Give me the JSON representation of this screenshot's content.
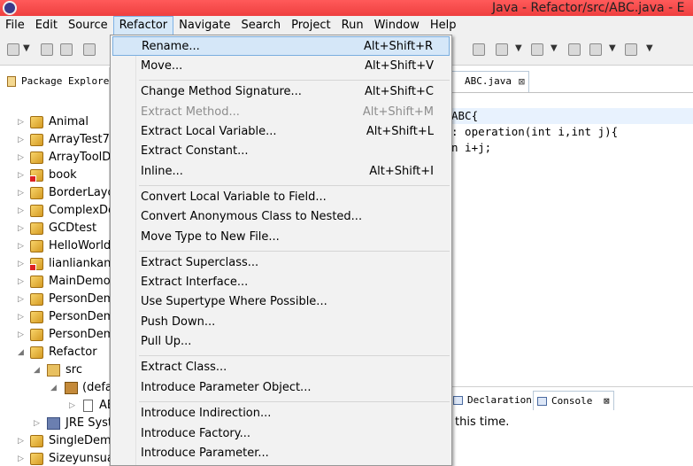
{
  "window": {
    "title": "Java - Refactor/src/ABC.java - E"
  },
  "menubar": {
    "items": [
      "File",
      "Edit",
      "Source",
      "Refactor",
      "Navigate",
      "Search",
      "Project",
      "Run",
      "Window",
      "Help"
    ],
    "active": "Refactor"
  },
  "package_explorer": {
    "tab_label": "Package Explorer",
    "tree": [
      {
        "label": "Animal",
        "kind": "project"
      },
      {
        "label": "ArrayTest7",
        "kind": "project"
      },
      {
        "label": "ArrayToolDe",
        "kind": "project"
      },
      {
        "label": "book",
        "kind": "project"
      },
      {
        "label": "BorderLayo",
        "kind": "project"
      },
      {
        "label": "ComplexDe",
        "kind": "project"
      },
      {
        "label": "GCDtest",
        "kind": "project"
      },
      {
        "label": "HelloWorld",
        "kind": "project"
      },
      {
        "label": "lianliankan",
        "kind": "project"
      },
      {
        "label": "MainDemo",
        "kind": "project"
      },
      {
        "label": "PersonDem",
        "kind": "project"
      },
      {
        "label": "PersonDem",
        "kind": "project"
      },
      {
        "label": "PersonDem",
        "kind": "project"
      },
      {
        "label": "Refactor",
        "kind": "project"
      },
      {
        "label": "src",
        "kind": "src"
      },
      {
        "label": "(defa",
        "kind": "package"
      },
      {
        "label": "AB",
        "kind": "file"
      },
      {
        "label": "JRE Syste",
        "kind": "jre"
      },
      {
        "label": "SingleDemo",
        "kind": "project"
      },
      {
        "label": "Sizeyunsuan",
        "kind": "project"
      }
    ]
  },
  "editor": {
    "tab_label": "ABC.java",
    "lines": [
      "ABC{",
      ": operation(int i,int j){",
      "n i+j;"
    ]
  },
  "bottom": {
    "tabs": [
      "Declaration",
      "Console"
    ],
    "active_tab": "Console",
    "console_text": "this time."
  },
  "refactor_menu": {
    "items": [
      {
        "label": "Rename...",
        "shortcut": "Alt+Shift+R",
        "state": "hover"
      },
      {
        "label": "Move...",
        "shortcut": "Alt+Shift+V",
        "state": "normal"
      },
      {
        "label": "Change Method Signature...",
        "shortcut": "Alt+Shift+C",
        "state": "normal"
      },
      {
        "label": "Extract Method...",
        "shortcut": "Alt+Shift+M",
        "state": "disabled"
      },
      {
        "label": "Extract Local Variable...",
        "shortcut": "Alt+Shift+L",
        "state": "normal"
      },
      {
        "label": "Extract Constant...",
        "shortcut": "",
        "state": "normal"
      },
      {
        "label": "Inline...",
        "shortcut": "Alt+Shift+I",
        "state": "normal"
      },
      {
        "label": "Convert Local Variable to Field...",
        "shortcut": "",
        "state": "normal"
      },
      {
        "label": "Convert Anonymous Class to Nested...",
        "shortcut": "",
        "state": "normal"
      },
      {
        "label": "Move Type to New File...",
        "shortcut": "",
        "state": "normal"
      },
      {
        "label": "Extract Superclass...",
        "shortcut": "",
        "state": "normal"
      },
      {
        "label": "Extract Interface...",
        "shortcut": "",
        "state": "normal"
      },
      {
        "label": "Use Supertype Where Possible...",
        "shortcut": "",
        "state": "normal"
      },
      {
        "label": "Push Down...",
        "shortcut": "",
        "state": "normal"
      },
      {
        "label": "Pull Up...",
        "shortcut": "",
        "state": "normal"
      },
      {
        "label": "Extract Class...",
        "shortcut": "",
        "state": "normal"
      },
      {
        "label": "Introduce Parameter Object...",
        "shortcut": "",
        "state": "normal"
      },
      {
        "label": "Introduce Indirection...",
        "shortcut": "",
        "state": "normal"
      },
      {
        "label": "Introduce Factory...",
        "shortcut": "",
        "state": "normal"
      },
      {
        "label": "Introduce Parameter...",
        "shortcut": "",
        "state": "normal"
      }
    ]
  }
}
